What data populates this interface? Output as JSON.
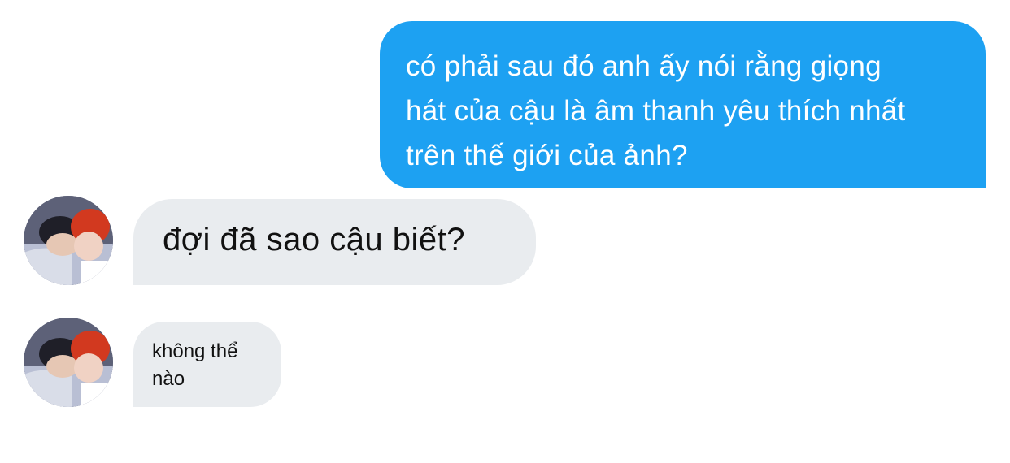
{
  "conversation": {
    "messages": [
      {
        "sender": "me",
        "text": "có phải sau đó anh ấy nói rằng giọng\nhát của cậu là âm thanh yêu thích nhất\ntrên thế giới của ảnh?"
      },
      {
        "sender": "other",
        "text": "đợi đã sao cậu biết?"
      },
      {
        "sender": "other",
        "text": "không thể\nnào"
      }
    ]
  },
  "colors": {
    "sent_bubble": "#1da1f2",
    "received_bubble": "#e9ecef",
    "sent_text": "#ffffff",
    "received_text": "#111111"
  },
  "icons": {
    "avatar": "avatar-photo-icon"
  }
}
